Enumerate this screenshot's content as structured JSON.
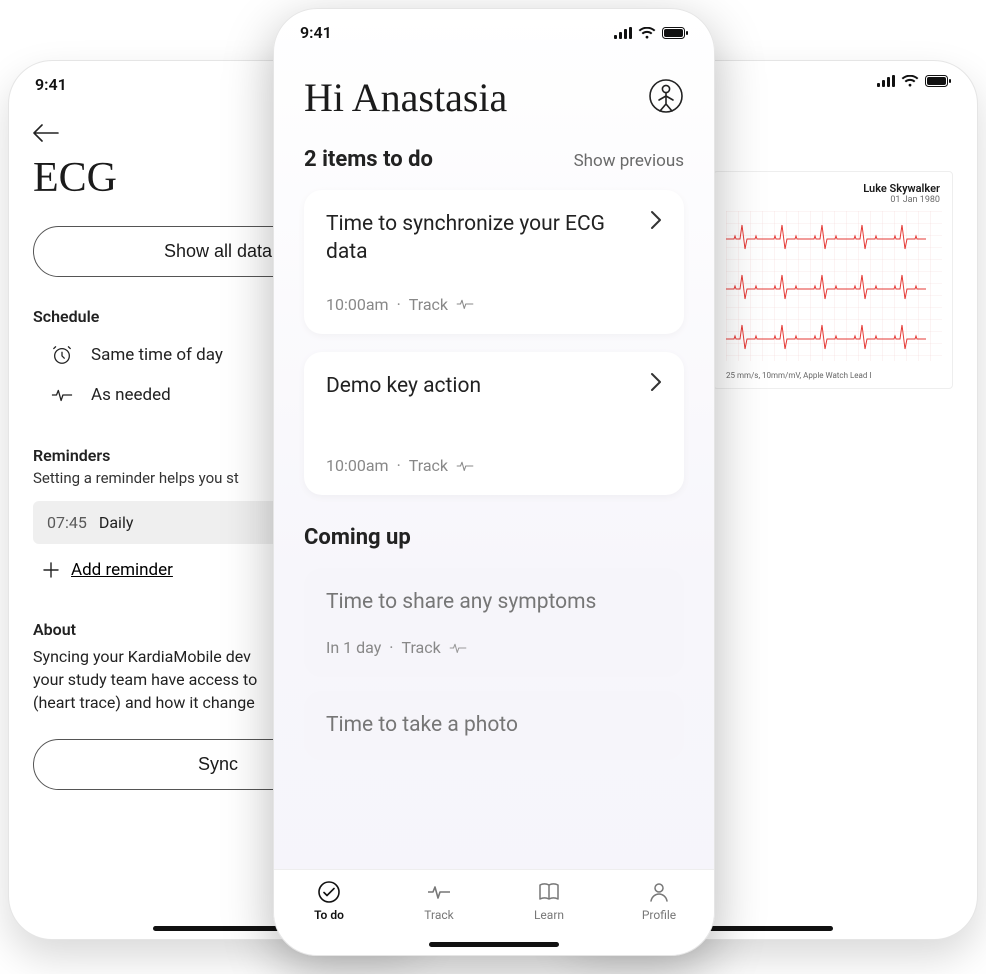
{
  "status_time": "9:41",
  "left": {
    "title": "ECG",
    "show_all": "Show all data",
    "schedule_label": "Schedule",
    "schedule_items": [
      {
        "icon": "clock-icon",
        "text": "Same time of day"
      },
      {
        "icon": "pulse-icon",
        "text": "As needed"
      }
    ],
    "reminders_label": "Reminders",
    "reminders_sub": "Setting a reminder helps you st",
    "reminder_time": "07:45",
    "reminder_freq": "Daily",
    "add_reminder": "Add reminder",
    "about_label": "About",
    "about_text": "Syncing your KardiaMobile de​v\nyour study team have access t​o\n(heart trace) and how it chang​e",
    "sync": "Sync"
  },
  "right": {
    "ecg_name": "Luke Skywalker",
    "ecg_date": "01 Jan 1980",
    "ecg_footer": "25 mm/s, 10mm/mV, Apple Watch Lead I"
  },
  "center": {
    "greeting": "Hi Anastasia",
    "todo_header": "2 items to do",
    "show_previous": "Show previous",
    "cards": [
      {
        "title": "Time to synchronize your ECG data",
        "meta_time": "10:00am",
        "meta_cat": "Track"
      },
      {
        "title": "Demo key action",
        "meta_time": "10:00am",
        "meta_cat": "Track"
      }
    ],
    "coming_up_label": "Coming up",
    "upcoming": [
      {
        "title": "Time to share any symptoms",
        "meta_time": "In 1 day",
        "meta_cat": "Track"
      },
      {
        "title": "Time to take a photo"
      }
    ],
    "tabs": [
      {
        "label": "To do",
        "active": true
      },
      {
        "label": "Track",
        "active": false
      },
      {
        "label": "Learn",
        "active": false
      },
      {
        "label": "Profile",
        "active": false
      }
    ]
  }
}
